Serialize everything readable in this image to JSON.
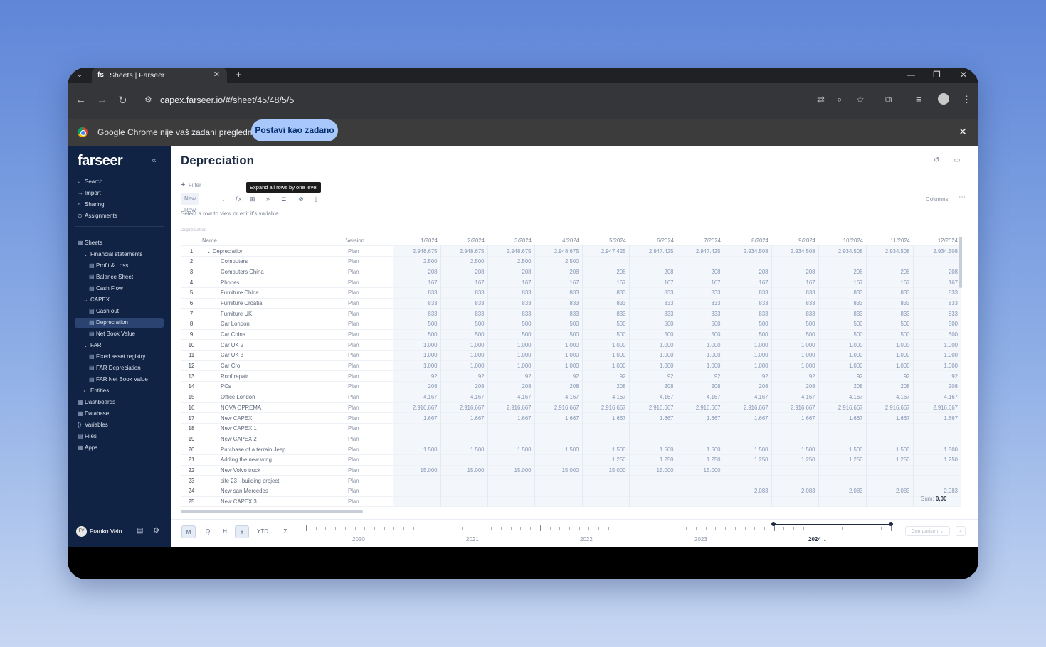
{
  "browser": {
    "tab_title": "Sheets | Farseer",
    "favicon": "fs",
    "url": "capex.farseer.io/#/sheet/45/48/5/5",
    "infobar_text": "Google Chrome nije vaš zadani preglednik",
    "infobar_button": "Postavi kao zadano"
  },
  "app": {
    "logo": "farseer",
    "nav": {
      "search": "Search",
      "import": "Import",
      "sharing": "Sharing",
      "assignments": "Assignments",
      "sheets": "Sheets",
      "financial_statements": "Financial statements",
      "profit_loss": "Profit & Loss",
      "balance_sheet": "Balance Sheet",
      "cash_flow": "Cash Flow",
      "capex": "CAPEX",
      "cash_out": "Cash out",
      "depreciation": "Depreciation",
      "net_book_value": "Net Book Value",
      "far": "FAR",
      "fixed_asset_registry": "Fixed asset registry",
      "far_depreciation": "FAR Depreciation",
      "far_net_book_value": "FAR Net Book Value",
      "entities": "Entities",
      "dashboards": "Dashboards",
      "database": "Database",
      "variables": "Variables",
      "files": "Files",
      "apps": "Apps"
    },
    "user": {
      "initials": "FV",
      "name": "Franko Vein"
    }
  },
  "sheet": {
    "title": "Depreciation",
    "filter": "Filter",
    "new_row": "New Row",
    "tooltip": "Expand all rows by one level",
    "hint": "Select a row to view or edit it's variable",
    "columns_label": "Columns",
    "grid_caption": "Depreciation",
    "headers": {
      "name": "Name",
      "version": "Version"
    },
    "months": [
      "1/2024",
      "2/2024",
      "3/2024",
      "4/2024",
      "5/2024",
      "6/2024",
      "7/2024",
      "8/2024",
      "9/2024",
      "10/2024",
      "11/2024",
      "12/2024"
    ],
    "rows": [
      {
        "n": "1",
        "name": "Depreciation",
        "ver": "Plan",
        "lvl": 0,
        "vals": [
          "2.948.675",
          "2.948.675",
          "2.948.675",
          "2.948.675",
          "2.947.425",
          "2.947.425",
          "2.947.425",
          "2.934.508",
          "2.934.508",
          "2.934.508",
          "2.934.508",
          "2.934.508"
        ]
      },
      {
        "n": "2",
        "name": "Computers",
        "ver": "Plan",
        "lvl": 1,
        "vals": [
          "2.500",
          "2.500",
          "2.500",
          "2.500",
          "",
          "",
          "",
          "",
          "",
          "",
          "",
          ""
        ]
      },
      {
        "n": "3",
        "name": "Computers China",
        "ver": "Plan",
        "lvl": 1,
        "vals": [
          "208",
          "208",
          "208",
          "208",
          "208",
          "208",
          "208",
          "208",
          "208",
          "208",
          "208",
          "208"
        ]
      },
      {
        "n": "4",
        "name": "Phones",
        "ver": "Plan",
        "lvl": 1,
        "vals": [
          "167",
          "167",
          "167",
          "167",
          "167",
          "167",
          "167",
          "167",
          "167",
          "167",
          "167",
          "167"
        ]
      },
      {
        "n": "5",
        "name": "Furniture China",
        "ver": "Plan",
        "lvl": 1,
        "vals": [
          "833",
          "833",
          "833",
          "833",
          "833",
          "833",
          "833",
          "833",
          "833",
          "833",
          "833",
          "833"
        ]
      },
      {
        "n": "6",
        "name": "Furniture Croatia",
        "ver": "Plan",
        "lvl": 1,
        "vals": [
          "833",
          "833",
          "833",
          "833",
          "833",
          "833",
          "833",
          "833",
          "833",
          "833",
          "833",
          "833"
        ]
      },
      {
        "n": "7",
        "name": "Furniture UK",
        "ver": "Plan",
        "lvl": 1,
        "vals": [
          "833",
          "833",
          "833",
          "833",
          "833",
          "833",
          "833",
          "833",
          "833",
          "833",
          "833",
          "833"
        ]
      },
      {
        "n": "8",
        "name": "Car London",
        "ver": "Plan",
        "lvl": 1,
        "vals": [
          "500",
          "500",
          "500",
          "500",
          "500",
          "500",
          "500",
          "500",
          "500",
          "500",
          "500",
          "500"
        ]
      },
      {
        "n": "9",
        "name": "Car China",
        "ver": "Plan",
        "lvl": 1,
        "vals": [
          "500",
          "500",
          "500",
          "500",
          "500",
          "500",
          "500",
          "500",
          "500",
          "500",
          "500",
          "500"
        ]
      },
      {
        "n": "10",
        "name": "Car UK 2",
        "ver": "Plan",
        "lvl": 1,
        "vals": [
          "1.000",
          "1.000",
          "1.000",
          "1.000",
          "1.000",
          "1.000",
          "1.000",
          "1.000",
          "1.000",
          "1.000",
          "1.000",
          "1.000"
        ]
      },
      {
        "n": "11",
        "name": "Car UK 3",
        "ver": "Plan",
        "lvl": 1,
        "vals": [
          "1.000",
          "1.000",
          "1.000",
          "1.000",
          "1.000",
          "1.000",
          "1.000",
          "1.000",
          "1.000",
          "1.000",
          "1.000",
          "1.000"
        ]
      },
      {
        "n": "12",
        "name": "Car Cro",
        "ver": "Plan",
        "lvl": 1,
        "vals": [
          "1.000",
          "1.000",
          "1.000",
          "1.000",
          "1.000",
          "1.000",
          "1.000",
          "1.000",
          "1.000",
          "1.000",
          "1.000",
          "1.000"
        ]
      },
      {
        "n": "13",
        "name": "Roof repair",
        "ver": "Plan",
        "lvl": 1,
        "vals": [
          "92",
          "92",
          "92",
          "92",
          "92",
          "92",
          "92",
          "92",
          "92",
          "92",
          "92",
          "92"
        ]
      },
      {
        "n": "14",
        "name": "PCs",
        "ver": "Plan",
        "lvl": 1,
        "vals": [
          "208",
          "208",
          "208",
          "208",
          "208",
          "208",
          "208",
          "208",
          "208",
          "208",
          "208",
          "208"
        ]
      },
      {
        "n": "15",
        "name": "Office London",
        "ver": "Plan",
        "lvl": 1,
        "vals": [
          "4.167",
          "4.167",
          "4.167",
          "4.167",
          "4.167",
          "4.167",
          "4.167",
          "4.167",
          "4.167",
          "4.167",
          "4.167",
          "4.167"
        ]
      },
      {
        "n": "16",
        "name": "NOVA OPREMA",
        "ver": "Plan",
        "lvl": 1,
        "vals": [
          "2.916.667",
          "2.916.667",
          "2.916.667",
          "2.916.667",
          "2.916.667",
          "2.916.667",
          "2.916.667",
          "2.916.667",
          "2.916.667",
          "2.916.667",
          "2.916.667",
          "2.916.667"
        ]
      },
      {
        "n": "17",
        "name": "New CAPEX",
        "ver": "Plan",
        "lvl": 1,
        "vals": [
          "1.667",
          "1.667",
          "1.667",
          "1.667",
          "1.667",
          "1.667",
          "1.667",
          "1.667",
          "1.667",
          "1.667",
          "1.667",
          "1.667"
        ]
      },
      {
        "n": "18",
        "name": "New CAPEX 1",
        "ver": "Plan",
        "lvl": 1,
        "vals": [
          "",
          "",
          "",
          "",
          "",
          "",
          "",
          "",
          "",
          "",
          "",
          ""
        ]
      },
      {
        "n": "19",
        "name": "New CAPEX 2",
        "ver": "Plan",
        "lvl": 1,
        "vals": [
          "",
          "",
          "",
          "",
          "",
          "",
          "",
          "",
          "",
          "",
          "",
          ""
        ]
      },
      {
        "n": "20",
        "name": "Purchase of a terrain Jeep",
        "ver": "Plan",
        "lvl": 1,
        "vals": [
          "1.500",
          "1.500",
          "1.500",
          "1.500",
          "1.500",
          "1.500",
          "1.500",
          "1.500",
          "1.500",
          "1.500",
          "1.500",
          "1.500"
        ]
      },
      {
        "n": "21",
        "name": "Adding the new wing",
        "ver": "Plan",
        "lvl": 1,
        "vals": [
          "",
          "",
          "",
          "",
          "1.250",
          "1.250",
          "1.250",
          "1.250",
          "1.250",
          "1.250",
          "1.250",
          "1.250"
        ]
      },
      {
        "n": "22",
        "name": "New Volvo truck",
        "ver": "Plan",
        "lvl": 1,
        "vals": [
          "15.000",
          "15.000",
          "15.000",
          "15.000",
          "15.000",
          "15.000",
          "15.000",
          "",
          "",
          "",
          "",
          ""
        ]
      },
      {
        "n": "23",
        "name": "site 23 - building project",
        "ver": "Plan",
        "lvl": 1,
        "vals": [
          "",
          "",
          "",
          "",
          "",
          "",
          "",
          "",
          "",
          "",
          "",
          ""
        ]
      },
      {
        "n": "24",
        "name": "New san Mercedes",
        "ver": "Plan",
        "lvl": 1,
        "vals": [
          "",
          "",
          "",
          "",
          "",
          "",
          "",
          "2.083",
          "2.083",
          "2.083",
          "2.083",
          "2.083"
        ]
      },
      {
        "n": "25",
        "name": "New CAPEX 3",
        "ver": "Plan",
        "lvl": 1,
        "vals": [
          "",
          "",
          "",
          "",
          "",
          "",
          "",
          "",
          "",
          "",
          "",
          ""
        ]
      }
    ],
    "sum_label": "Sum:",
    "sum_value": "0,00"
  },
  "timeline": {
    "buttons": [
      "M",
      "Q",
      "H",
      "Y",
      "YTD",
      "Σ"
    ],
    "years": [
      "2020",
      "2021",
      "2022",
      "2023",
      "2024"
    ],
    "comparison": "Comparison",
    "close": "×"
  }
}
